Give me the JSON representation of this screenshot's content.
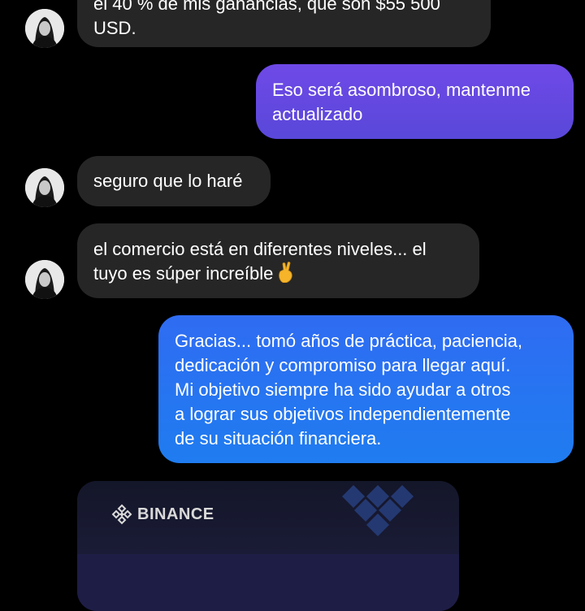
{
  "messages": [
    {
      "type": "incoming",
      "text": "el 40 % de mis ganancias, que son $55 500\nUSD."
    },
    {
      "type": "outgoing",
      "text": "Eso será asombroso, mantenme\nactualizado"
    },
    {
      "type": "incoming",
      "text": "seguro que lo haré"
    },
    {
      "type": "incoming",
      "text": "el comercio está en diferentes niveles... el\ntuyo es súper increíble"
    },
    {
      "type": "outgoing",
      "text": "Gracias... tomó años de práctica, paciencia,\ndedicación y compromiso para llegar aquí.\nMi objetivo siempre ha sido ayudar a otros\na lograr sus objetivos independientemente\nde su situación financiera."
    }
  ],
  "emoji": {
    "icon": "crossed-fingers-emoji"
  },
  "card": {
    "brand": "BINANCE"
  },
  "colors": {
    "incoming_bubble": "#262626",
    "outgoing_purple_start": "#7048e8",
    "outgoing_purple_end": "#5a48d8",
    "outgoing_blue_start": "#2f6df2",
    "outgoing_blue_end": "#1f7cf0",
    "binance_card": "#1e1d46"
  }
}
